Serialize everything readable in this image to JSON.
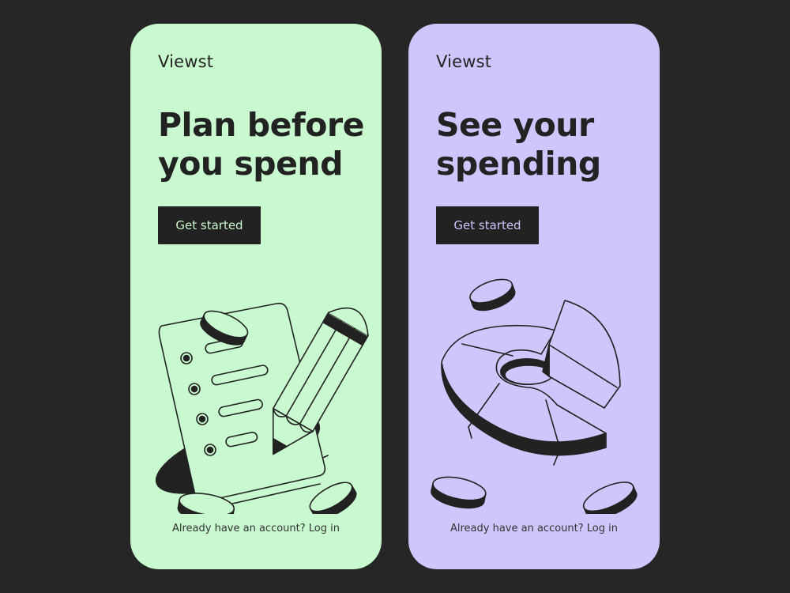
{
  "colors": {
    "background": "#262626",
    "ink": "#222222"
  },
  "cards": [
    {
      "id": "plan",
      "background": "#c9f9cf",
      "button_text_color": "#c9f9cf",
      "logo": "Viewst",
      "headline_line1": "Plan before",
      "headline_line2": "you spend",
      "cta_label": "Get started",
      "footer_text": "Already have an account?",
      "footer_link": "Log in",
      "illustration": "checklist-pencil-icon"
    },
    {
      "id": "see",
      "background": "#cec7fd",
      "button_text_color": "#cec7fd",
      "logo": "Viewst",
      "headline_line1": "See your",
      "headline_line2": "spending",
      "cta_label": "Get started",
      "footer_text": "Already have an account?",
      "footer_link": "Log in",
      "illustration": "donut-chart-icon"
    }
  ]
}
